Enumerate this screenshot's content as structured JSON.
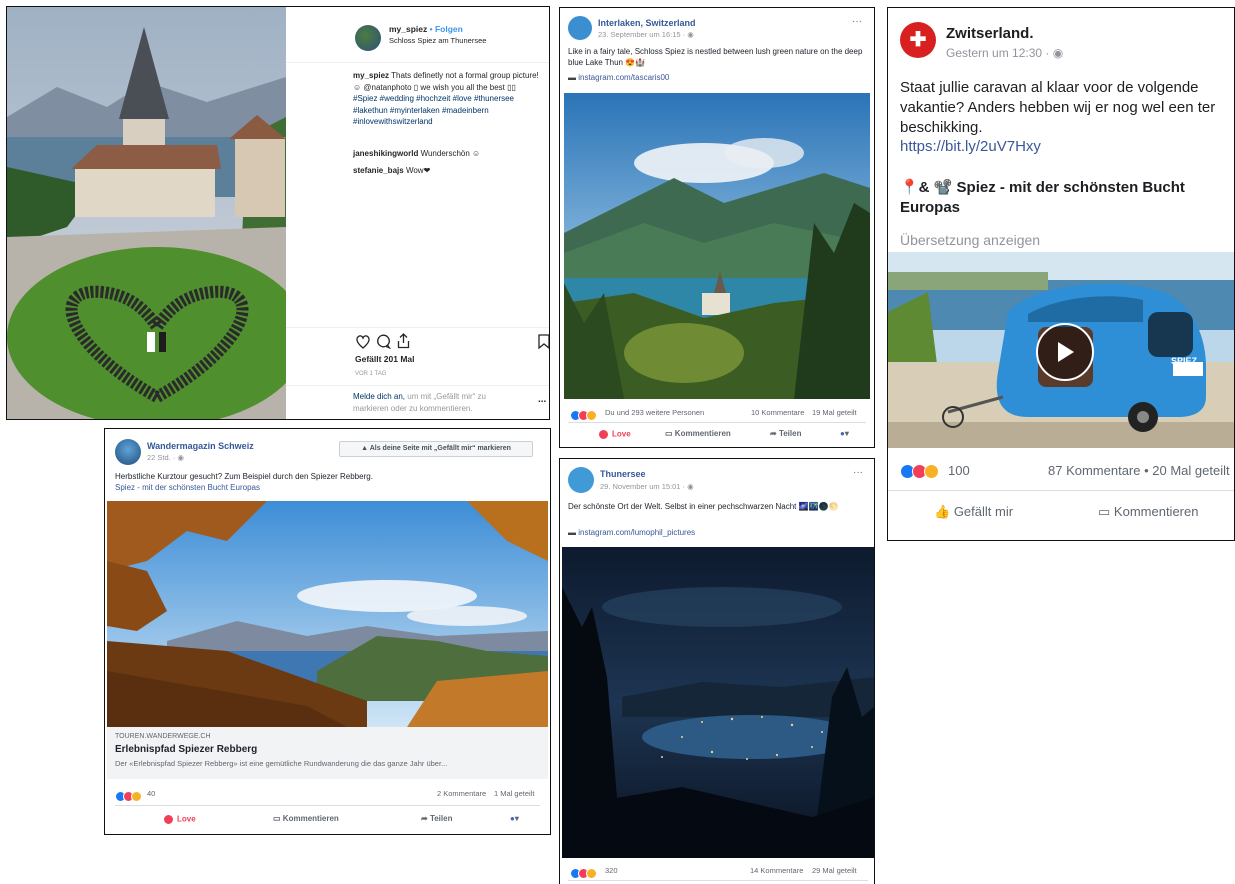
{
  "instagram": {
    "username": "my_spiez",
    "follow": "• Folgen",
    "location": "Schloss Spiez am Thunersee",
    "caption_user": "my_spiez",
    "caption": "Thats definetly not a formal group picture! ☺ @natanphoto ▯ we wish you all the best ▯▯",
    "hashtags": "#Spiez #wedding #hochzeit #love #thunersee #lakethun #myinterlaken #madeinbern #inlovewithswitzerland",
    "comment1_user": "janeshikingworld",
    "comment1_text": "Wunderschön ☺",
    "comment2_user": "stefanie_bajs",
    "comment2_text": "Wow❤",
    "likes": "Gefällt 201 Mal",
    "time": "VOR 1 TAG",
    "login_link": "Melde dich an,",
    "login_text": "um mit „Gefällt mir“ zu markieren oder zu kommentieren.",
    "more": "..."
  },
  "interlaken": {
    "page": "Interlaken, Switzerland",
    "date": "23. September um 16:15 · ",
    "text": "Like in a fairy tale, Schloss Spiez is nestled between lush green nature on the deep blue Lake Thun 😍🏰",
    "link": "instagram.com/tascaris00",
    "reactions": "Du und 293 weitere Personen",
    "comments": "10 Kommentare",
    "shares": "19 Mal geteilt",
    "action_love": "Love",
    "action_comment": "Kommentieren",
    "action_share": "Teilen",
    "more": "···"
  },
  "zwitserland": {
    "page": "Zwitserland.",
    "date": "Gestern um 12:30 · ",
    "text": "Staat jullie caravan al klaar voor de volgende vakantie? Anders hebben wij er nog wel een ter beschikking.",
    "link": "https://bit.ly/2uV7Hxy",
    "headline_icons": "📍& 📽️",
    "headline": "Spiez - mit der schönsten Bucht Europas",
    "translate": "Übersetzung anzeigen",
    "reactions": "100",
    "stats": "87 Kommentare • 20 Mal geteilt",
    "action_like": "Gefällt mir",
    "action_comment": "Kommentieren",
    "badge": "SPIEZ"
  },
  "wandermagazin": {
    "page": "Wandermagazin Schweiz",
    "date": "22 Std. · ",
    "like_page_button": "Als deine Seite mit „Gefällt mir“ markieren",
    "text": "Herbstliche Kurztour gesucht? Zum Beispiel durch den Spiezer Rebberg.",
    "link": "Spiez - mit der schönsten Bucht Europas",
    "domain": "TOUREN.WANDERWEGE.CH",
    "title": "Erlebnispfad Spiezer Rebberg",
    "desc": "Der «Erlebnispfad Spiezer Rebberg» ist eine gemütliche Rundwanderung die das ganze Jahr über...",
    "reactions": "40",
    "comments": "2 Kommentare",
    "shares": "1 Mal geteilt",
    "action_love": "Love",
    "action_comment": "Kommentieren",
    "action_share": "Teilen"
  },
  "thunersee": {
    "page": "Thunersee",
    "date": "29. November um 15:01 · ",
    "text": "Der schönste Ort der Welt. Selbst in einer pechschwarzen Nacht 🌌🌃🌑🌕",
    "link": "instagram.com/lumophil_pictures",
    "reactions": "320",
    "comments": "14 Kommentare",
    "shares": "29 Mal geteilt",
    "more": "···"
  }
}
